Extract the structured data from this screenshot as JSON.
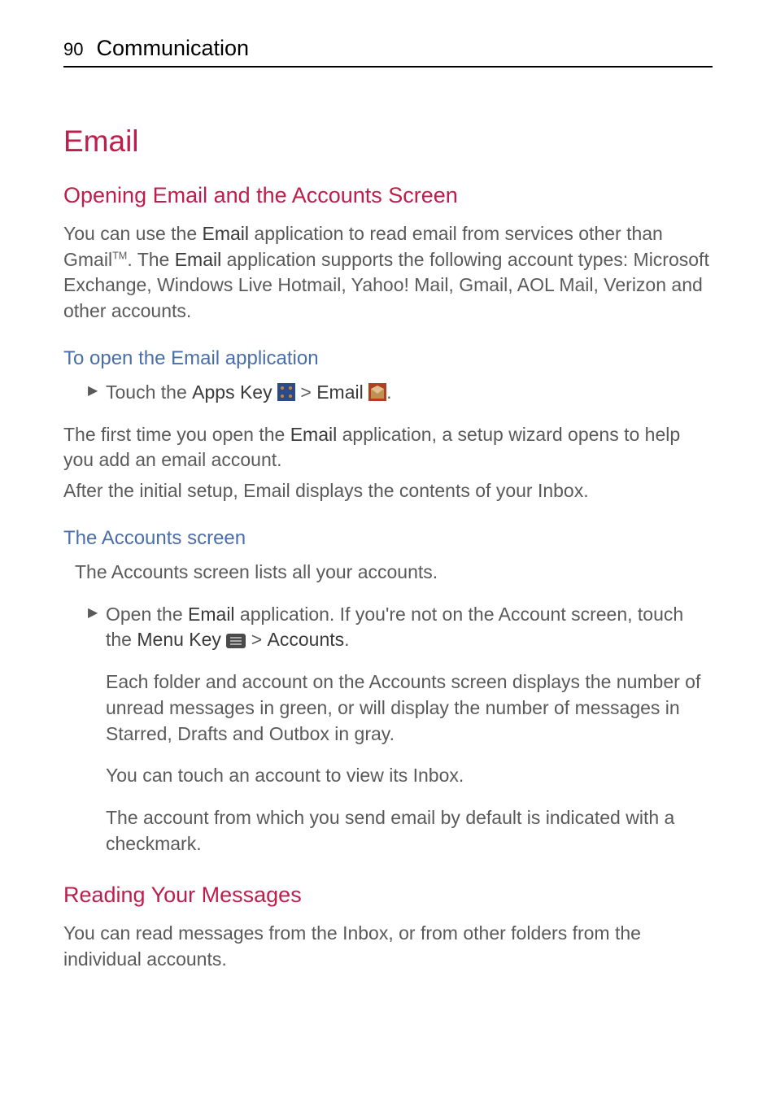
{
  "header": {
    "page_number": "90",
    "section": "Communication"
  },
  "title": "Email",
  "section1": {
    "heading": "Opening Email and the Accounts Screen",
    "intro_1": "You can use the ",
    "intro_2_bold": "Email",
    "intro_3": " application to read email from services other than Gmail",
    "intro_tm": "TM",
    "intro_4": ". The ",
    "intro_5_bold": "Email",
    "intro_6": " application supports the following account types: Microsoft Exchange, Windows Live Hotmail, Yahoo! Mail, Gmail, AOL Mail, Verizon and other accounts.",
    "sub1": {
      "heading": "To open the Email application",
      "bullet_1": "Touch the ",
      "bullet_2_bold": "Apps Key",
      "bullet_3": " ",
      "bullet_4": " > ",
      "bullet_5_bold": "Email",
      "bullet_6": " ",
      "bullet_7": ".",
      "post_1": "The first time you open the ",
      "post_2_bold": "Email",
      "post_3": " application, a setup wizard opens to help you add an email account.",
      "post_4": "After the initial setup, Email displays the contents of your Inbox."
    },
    "sub2": {
      "heading": "The Accounts screen",
      "intro": "The Accounts screen lists all your accounts.",
      "bullet_1": "Open the ",
      "bullet_2_bold": "Email",
      "bullet_3": " application. If you're not on the Account screen, touch the ",
      "bullet_4_bold": "Menu Key",
      "bullet_5": " ",
      "bullet_6": " > ",
      "bullet_7_bold": "Accounts",
      "bullet_8": ".",
      "desc1": "Each folder and account on the Accounts screen displays the number of unread messages in green, or will display the number of messages in Starred, Drafts and Outbox in gray.",
      "desc2": "You can touch an account to view its Inbox.",
      "desc3": "The account from which you send email by default is indicated with a checkmark."
    }
  },
  "section2": {
    "heading": "Reading Your Messages",
    "body": "You can read messages from the Inbox, or from other folders from the individual accounts."
  },
  "icons": {
    "apps_key": "apps-key-icon",
    "email": "email-icon",
    "menu_key": "menu-key-icon"
  }
}
